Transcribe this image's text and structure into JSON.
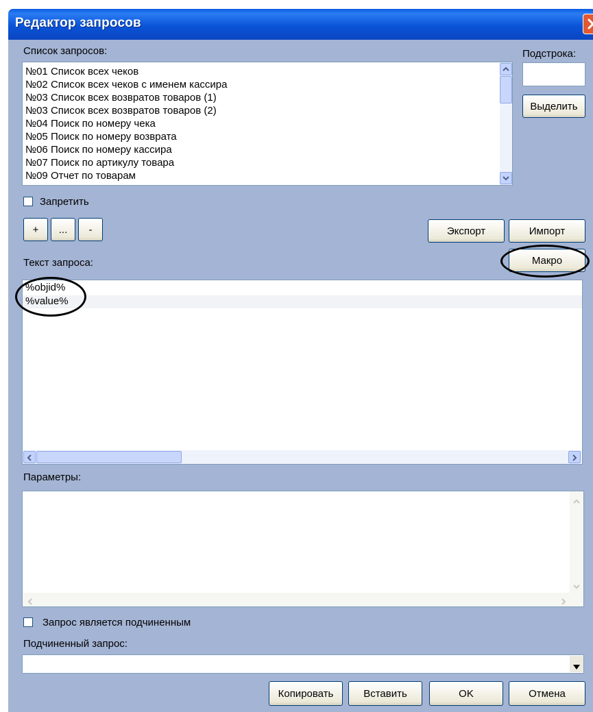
{
  "window": {
    "title": "Редактор запросов"
  },
  "query_list": {
    "label": "Список запросов:",
    "items": [
      "№01 Список всех чеков",
      "№02 Список всех чеков с именем кассира",
      "№03 Список всех возвратов товаров (1)",
      "№03 Список всех возвратов товаров (2)",
      "№04 Поиск по номеру чека",
      "№05 Поиск по номеру возврата",
      "№06 Поиск по номеру кассира",
      "№07 Поиск по артикулу товара",
      "№09 Отчет по товарам"
    ]
  },
  "substring": {
    "label": "Подстрока:",
    "value": "",
    "select_button": "Выделить"
  },
  "forbid": {
    "label": "Запретить",
    "checked": false
  },
  "list_buttons": {
    "add": "+",
    "edit": "...",
    "remove": "-"
  },
  "export_button": "Экспорт",
  "import_button": "Импорт",
  "macro_button": "Макро",
  "query_text": {
    "label": "Текст запроса:",
    "lines": [
      "%objid%",
      "%value%"
    ]
  },
  "parameters": {
    "label": "Параметры:"
  },
  "subordinate": {
    "checkbox_label": "Запрос является подчиненным",
    "checked": false,
    "select_label": "Подчиненный запрос:",
    "select_value": ""
  },
  "footer": {
    "copy": "Копировать",
    "paste": "Вставить",
    "ok": "OK",
    "cancel": "Отмена"
  },
  "colors": {
    "title_bar": "#0a54d8",
    "client_bg": "#a4b4d4",
    "annotation": "#000000"
  }
}
